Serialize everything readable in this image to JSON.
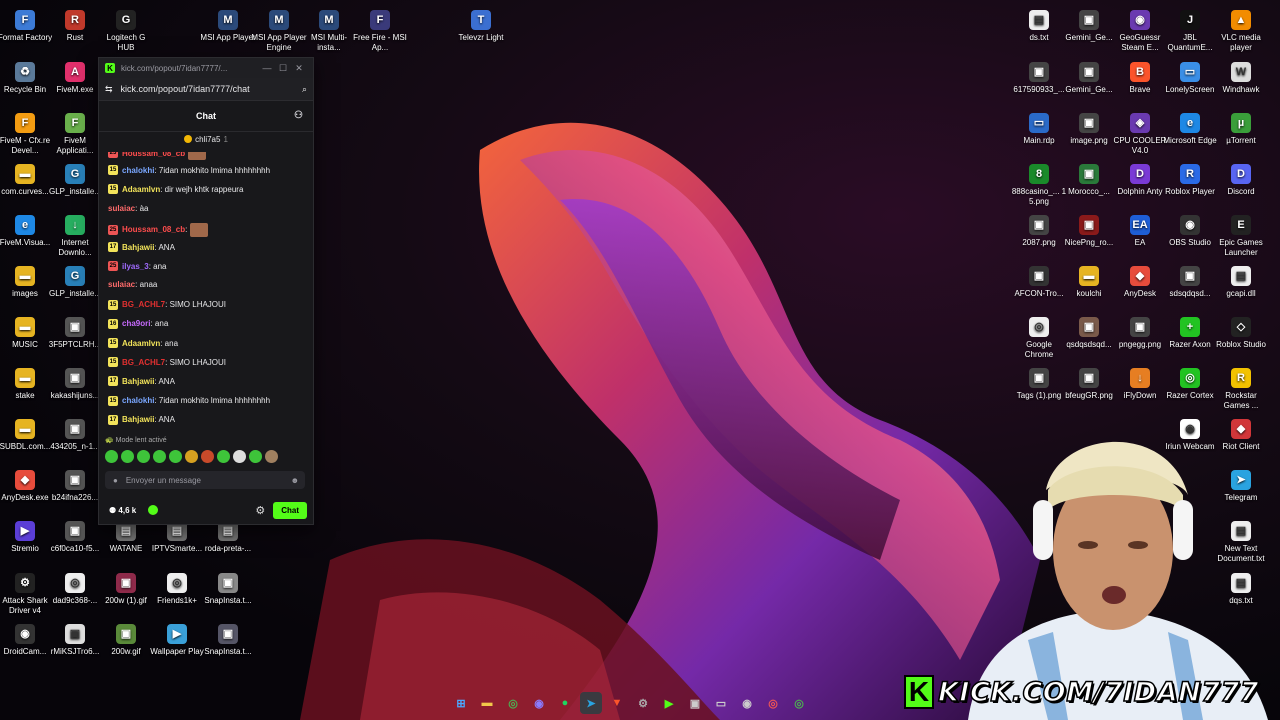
{
  "desktop_icons": [
    {
      "label": "Format Factory",
      "color": "#3c7bd6",
      "icon": "format-factory-icon",
      "glyph": "F"
    },
    {
      "label": "Rust",
      "color": "#c0392b",
      "icon": "rust-icon",
      "glyph": "R"
    },
    {
      "label": "Logitech G HUB",
      "color": "#222",
      "icon": "logitech-icon",
      "glyph": "G"
    },
    {
      "label": "MSI App Player",
      "color": "#2b4a7a",
      "icon": "msi-app-player-icon",
      "glyph": "M"
    },
    {
      "label": "MSI App Player Engine",
      "color": "#2b4a7a",
      "icon": "msi-engine-icon",
      "glyph": "M"
    },
    {
      "label": "MSI Multi-insta...",
      "color": "#2b4a7a",
      "icon": "msi-multi-icon",
      "glyph": "M"
    },
    {
      "label": "Free Fire - MSI Ap...",
      "color": "#3a3a7a",
      "icon": "free-fire-icon",
      "glyph": "F"
    },
    {
      "label": "Televzr Light",
      "color": "#3b6fd1",
      "icon": "televzr-icon",
      "glyph": "T"
    },
    {
      "label": "Recycle Bin",
      "color": "#5b7a9a",
      "icon": "recycle-bin-icon",
      "glyph": "♻"
    },
    {
      "label": "FiveM.exe",
      "color": "#e1306c",
      "icon": "fivem-exe-icon",
      "glyph": "A"
    },
    {
      "label": "FiveM - Cfx.re Devel...",
      "color": "#f39c12",
      "icon": "fivem-cfx-icon",
      "glyph": "F"
    },
    {
      "label": "FiveM Applicati...",
      "color": "#6ab04c",
      "icon": "fivem-app-icon",
      "glyph": "F"
    },
    {
      "label": "com.curves...",
      "color": "#e6b422",
      "icon": "folder-icon",
      "glyph": "▬"
    },
    {
      "label": "GLP_installe...",
      "color": "#2980b9",
      "icon": "glp-installer-icon",
      "glyph": "G"
    },
    {
      "label": "FiveM.Visua...",
      "color": "#1e88e5",
      "icon": "edge-icon",
      "glyph": "e"
    },
    {
      "label": "Internet Downlo...",
      "color": "#27ae60",
      "icon": "internet-download-icon",
      "glyph": "↓"
    },
    {
      "label": "images",
      "color": "#e6b422",
      "icon": "folder-icon",
      "glyph": "▬"
    },
    {
      "label": "GLP_installe...",
      "color": "#2980b9",
      "icon": "glp-installer-icon",
      "glyph": "G"
    },
    {
      "label": "MUSIC",
      "color": "#e6b422",
      "icon": "folder-icon",
      "glyph": "▬"
    },
    {
      "label": "3F5PTCLRH...",
      "color": "#555",
      "icon": "image-file-icon",
      "glyph": "▣"
    },
    {
      "label": "stake",
      "color": "#e6b422",
      "icon": "folder-icon",
      "glyph": "▬"
    },
    {
      "label": "kakashijuns...",
      "color": "#555",
      "icon": "image-file-icon",
      "glyph": "▣"
    },
    {
      "label": "SUBDL.com...",
      "color": "#e6b422",
      "icon": "folder-icon",
      "glyph": "▬"
    },
    {
      "label": "434205_n-1...",
      "color": "#555",
      "icon": "image-file-icon",
      "glyph": "▣"
    },
    {
      "label": "AnyDesk.exe",
      "color": "#e74c3c",
      "icon": "anydesk-icon",
      "glyph": "◆"
    },
    {
      "label": "b24ifna226...",
      "color": "#555",
      "icon": "image-file-icon",
      "glyph": "▣"
    },
    {
      "label": "Stremio",
      "color": "#5b3ed6",
      "icon": "stremio-icon",
      "glyph": "▶"
    },
    {
      "label": "c6f0ca10-f5...",
      "color": "#555",
      "icon": "image-file-icon",
      "glyph": "▣"
    },
    {
      "label": "WATANE",
      "color": "#777",
      "icon": "file-icon",
      "glyph": "▤"
    },
    {
      "label": "IPTVSmarte...",
      "color": "#777",
      "icon": "file-icon",
      "glyph": "▤"
    },
    {
      "label": "roda-preta-...",
      "color": "#777",
      "icon": "file-icon",
      "glyph": "▤"
    },
    {
      "label": "Attack Shark Driver v4",
      "color": "#222",
      "icon": "attack-shark-icon",
      "glyph": "⚙"
    },
    {
      "label": "dad9c368-...",
      "color": "#eee",
      "icon": "chrome-html-icon",
      "glyph": "◎"
    },
    {
      "label": "200w (1).gif",
      "color": "#8e2a4a",
      "icon": "gif-icon",
      "glyph": "▣"
    },
    {
      "label": "Friends1k+",
      "color": "#eee",
      "icon": "chrome-html-icon",
      "glyph": "◎"
    },
    {
      "label": "SnapInsta.t...",
      "color": "#888",
      "icon": "image-file-icon",
      "glyph": "▣"
    },
    {
      "label": "DroidCam...",
      "color": "#333",
      "icon": "droidcam-icon",
      "glyph": "◉"
    },
    {
      "label": "rMiKSJTro6...",
      "color": "#ddd",
      "icon": "image-file-icon",
      "glyph": "▣"
    },
    {
      "label": "200w.gif",
      "color": "#5a8a3a",
      "icon": "gif-icon",
      "glyph": "▣"
    },
    {
      "label": "Wallpaper Play",
      "color": "#3aa0d8",
      "icon": "wallpaper-play-icon",
      "glyph": "▶"
    },
    {
      "label": "SnapInsta.t...",
      "color": "#556",
      "icon": "image-file-icon",
      "glyph": "▣"
    },
    {
      "label": "ds.txt",
      "color": "#eee",
      "icon": "text-file-icon",
      "glyph": "▤"
    },
    {
      "label": "Gemini_Ge...",
      "color": "#444",
      "icon": "image-file-icon",
      "glyph": "▣"
    },
    {
      "label": "GeoGuessr Steam E...",
      "color": "#6a3ab0",
      "icon": "geoguessr-icon",
      "glyph": "◉"
    },
    {
      "label": "JBL QuantumE...",
      "color": "#111",
      "icon": "jbl-icon",
      "glyph": "J"
    },
    {
      "label": "VLC media player",
      "color": "#f28c00",
      "icon": "vlc-icon",
      "glyph": "▲"
    },
    {
      "label": "617590933_...",
      "color": "#444",
      "icon": "image-file-icon",
      "glyph": "▣"
    },
    {
      "label": "Gemini_Ge...",
      "color": "#444",
      "icon": "image-file-icon",
      "glyph": "▣"
    },
    {
      "label": "Brave",
      "color": "#fb542b",
      "icon": "brave-icon",
      "glyph": "B"
    },
    {
      "label": "LonelyScreen",
      "color": "#3a8ee6",
      "icon": "lonelyscreen-icon",
      "glyph": "▭"
    },
    {
      "label": "Windhawk",
      "color": "#ddd",
      "icon": "windhawk-icon",
      "glyph": "W"
    },
    {
      "label": "Main.rdp",
      "color": "#2a6ac8",
      "icon": "rdp-icon",
      "glyph": "▭"
    },
    {
      "label": "image.png",
      "color": "#444",
      "icon": "image-file-icon",
      "glyph": "▣"
    },
    {
      "label": "CPU COOLER V4.0",
      "color": "#6a3ab0",
      "icon": "cpu-cooler-icon",
      "glyph": "◈"
    },
    {
      "label": "Microsoft Edge",
      "color": "#1e88e5",
      "icon": "edge-icon",
      "glyph": "e"
    },
    {
      "label": "µTorrent",
      "color": "#3a9e3a",
      "icon": "utorrent-icon",
      "glyph": "µ"
    },
    {
      "label": "888casino_... 1 5.png",
      "color": "#1a8a2a",
      "icon": "image-file-icon",
      "glyph": "8"
    },
    {
      "label": "Morocco_...",
      "color": "#2a7a3a",
      "icon": "image-file-icon",
      "glyph": "▣"
    },
    {
      "label": "Dolphin Anty",
      "color": "#7a3ad6",
      "icon": "dolphin-anty-icon",
      "glyph": "D"
    },
    {
      "label": "Roblox Player",
      "color": "#2a6ae6",
      "icon": "roblox-player-icon",
      "glyph": "R"
    },
    {
      "label": "Discord",
      "color": "#5865f2",
      "icon": "discord-icon",
      "glyph": "D"
    },
    {
      "label": "2087.png",
      "color": "#444",
      "icon": "image-file-icon",
      "glyph": "▣"
    },
    {
      "label": "NicePng_ro...",
      "color": "#8a1a1a",
      "icon": "image-file-icon",
      "glyph": "▣"
    },
    {
      "label": "EA",
      "color": "#1e5ed6",
      "icon": "ea-icon",
      "glyph": "EA"
    },
    {
      "label": "OBS Studio",
      "color": "#333",
      "icon": "obs-icon",
      "glyph": "◉"
    },
    {
      "label": "Epic Games Launcher",
      "color": "#222",
      "icon": "epic-games-icon",
      "glyph": "E"
    },
    {
      "label": "AFCON-Tro...",
      "color": "#333",
      "icon": "image-file-icon",
      "glyph": "▣"
    },
    {
      "label": "koulchi",
      "color": "#e6b422",
      "icon": "folder-icon",
      "glyph": "▬"
    },
    {
      "label": "AnyDesk",
      "color": "#e74c3c",
      "icon": "anydesk-icon",
      "glyph": "◆"
    },
    {
      "label": "sdsqdqsd...",
      "color": "#444",
      "icon": "image-file-icon",
      "glyph": "▣"
    },
    {
      "label": "gcapi.dll",
      "color": "#eee",
      "icon": "dll-file-icon",
      "glyph": "▤"
    },
    {
      "label": "Google Chrome",
      "color": "#eee",
      "icon": "chrome-icon",
      "glyph": "◎"
    },
    {
      "label": "qsdqsdsqd...",
      "color": "#7a5a4a",
      "icon": "image-file-icon",
      "glyph": "▣"
    },
    {
      "label": "pngegg.png",
      "color": "#444",
      "icon": "image-file-icon",
      "glyph": "▣"
    },
    {
      "label": "Razer Axon",
      "color": "#22c322",
      "icon": "razer-axon-icon",
      "glyph": "+"
    },
    {
      "label": "Roblox Studio",
      "color": "#222",
      "icon": "roblox-studio-icon",
      "glyph": "◇"
    },
    {
      "label": "Tags (1).png",
      "color": "#444",
      "icon": "image-file-icon",
      "glyph": "▣"
    },
    {
      "label": "bfeugGR.png",
      "color": "#444",
      "icon": "image-file-icon",
      "glyph": "▣"
    },
    {
      "label": "iFlyDown",
      "color": "#e67e22",
      "icon": "iflydown-icon",
      "glyph": "↓"
    },
    {
      "label": "Razer Cortex",
      "color": "#22c322",
      "icon": "razer-cortex-icon",
      "glyph": "◎"
    },
    {
      "label": "Rockstar Games ...",
      "color": "#f2c200",
      "icon": "rockstar-icon",
      "glyph": "R"
    },
    {
      "label": "Iriun Webcam",
      "color": "#fff",
      "icon": "iriun-webcam-icon",
      "glyph": "◉"
    },
    {
      "label": "Riot Client",
      "color": "#d13639",
      "icon": "riot-client-icon",
      "glyph": "◆"
    },
    {
      "label": "Telegram",
      "color": "#2aa3e0",
      "icon": "telegram-icon",
      "glyph": "➤"
    },
    {
      "label": "New Text Document.txt",
      "color": "#eee",
      "icon": "text-file-icon",
      "glyph": "▤"
    },
    {
      "label": "dqs.txt",
      "color": "#eee",
      "icon": "text-file-icon",
      "glyph": "▤"
    }
  ],
  "chat_window": {
    "title": "kick.com/popout/7idan7777/...",
    "minimize": "—",
    "maximize": "☐",
    "close": "✕",
    "url": "kick.com/popout/7idan7777/chat",
    "header": "Chat",
    "pinned_user": "chli7a5",
    "pinned_count": "1",
    "messages": [
      {
        "user": "Houssam_08_cb",
        "text": "",
        "color": "#ff4d4d",
        "badge": "25",
        "badge_color": "#e55"
      },
      {
        "user": "chalokhi",
        "text": ": 7idan mokhito lmima hhhhhhhh",
        "color": "#7aa7ff",
        "badge": "15",
        "badge_color": "#f2e35a"
      },
      {
        "user": "Adaamlvn",
        "text": ": dir wejh khtk rappeura",
        "color": "#f2e35a",
        "badge": "15",
        "badge_color": "#f2e35a"
      },
      {
        "user": "sulaiac",
        "text": ": àa",
        "color": "#ff6b6b",
        "badge": "",
        "badge_color": ""
      },
      {
        "user": "Houssam_08_cb",
        "text": ":",
        "color": "#ff4d4d",
        "badge": "25",
        "badge_color": "#e55"
      },
      {
        "user": "Bahjawii",
        "text": ": ANA",
        "color": "#f2e35a",
        "badge": "17",
        "badge_color": "#f2e35a"
      },
      {
        "user": "ilyas_3",
        "text": ": ana",
        "color": "#a06bff",
        "badge": "25",
        "badge_color": "#e55"
      },
      {
        "user": "sulaiac",
        "text": ": anaa",
        "color": "#ff6b6b",
        "badge": "",
        "badge_color": ""
      },
      {
        "user": "BG_ACHL7",
        "text": ": SIMO LHAJOUI",
        "color": "#e03030",
        "badge": "15",
        "badge_color": "#f2e35a"
      },
      {
        "user": "cha9ori",
        "text": ": ana",
        "color": "#c86bff",
        "badge": "16",
        "badge_color": "#f2e35a"
      },
      {
        "user": "Adaamlvn",
        "text": ": ana",
        "color": "#f2e35a",
        "badge": "15",
        "badge_color": "#f2e35a"
      },
      {
        "user": "BG_ACHL7",
        "text": ": SIMO LHAJOUI",
        "color": "#e03030",
        "badge": "15",
        "badge_color": "#f2e35a"
      },
      {
        "user": "Bahjawii",
        "text": ": ANA",
        "color": "#f2e35a",
        "badge": "17",
        "badge_color": "#f2e35a"
      },
      {
        "user": "chalokhi",
        "text": ": 7idan mokhito lmima hhhhhhhh",
        "color": "#7aa7ff",
        "badge": "15",
        "badge_color": "#f2e35a"
      },
      {
        "user": "Bahjawii",
        "text": ": ANA",
        "color": "#f2e35a",
        "badge": "17",
        "badge_color": "#f2e35a"
      }
    ],
    "slow_mode": "Mode lent activé",
    "input_placeholder": "Envoyer un message",
    "viewers": "4,6 k",
    "send_label": "Chat"
  },
  "stream_overlay": {
    "url_text": "KICK.COM/7IDAN777",
    "k_letter": "K"
  }
}
